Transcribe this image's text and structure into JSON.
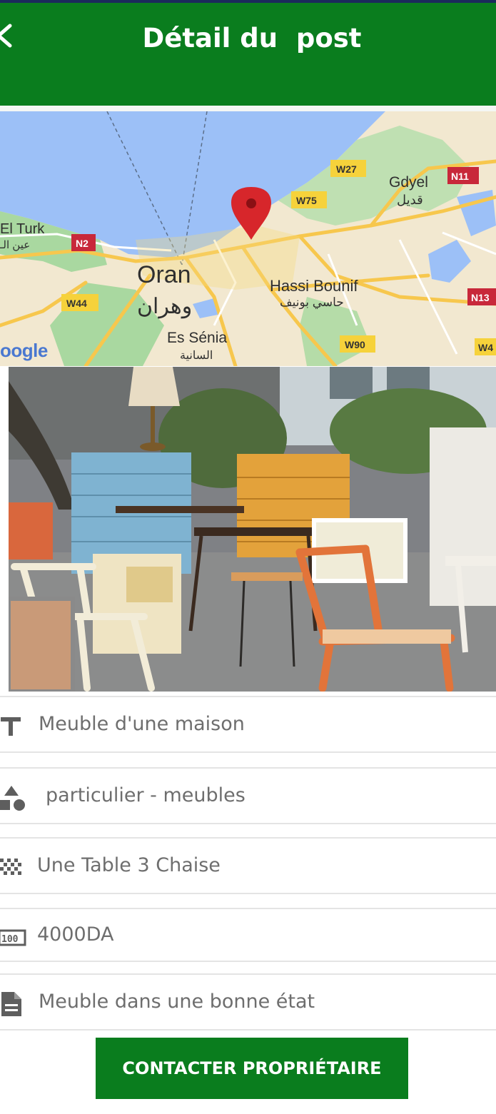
{
  "header": {
    "title": "Détail du  post",
    "back_icon": "back-arrow-icon"
  },
  "map": {
    "pin_icon": "map-pin-icon",
    "brand": "oogle",
    "places": [
      {
        "name": "Oran",
        "name_ar": "وهران"
      },
      {
        "name": "Gdyel",
        "name_ar": "قديل"
      },
      {
        "name": "Hassi Bounif",
        "name_ar": "حاسي بونيف"
      },
      {
        "name": "Es Sénia",
        "name_ar": "السانية"
      },
      {
        "name": "El Turk",
        "name_ar": "عين الـ"
      }
    ],
    "roads": [
      "W27",
      "N11",
      "W75",
      "N2",
      "W44",
      "N13",
      "W90",
      "W4"
    ]
  },
  "photo": {
    "description_icon": "furniture-photo"
  },
  "fields": [
    {
      "icon": "text-title-icon",
      "value": "Meuble d'une maison"
    },
    {
      "icon": "category-shapes-icon",
      "value": "particulier - meubles"
    },
    {
      "icon": "grid-dots-icon",
      "value": "Une Table 3 Chaise"
    },
    {
      "icon": "price-counter-icon",
      "value": "4000DA"
    },
    {
      "icon": "document-icon",
      "value": "Meuble dans une bonne état"
    }
  ],
  "actions": {
    "contact_label": "CONTACTER PROPRIÉTAIRE"
  },
  "colors": {
    "primary": "#0a7d1e",
    "status_bar": "#1b2a5c",
    "pin": "#d7262b"
  }
}
